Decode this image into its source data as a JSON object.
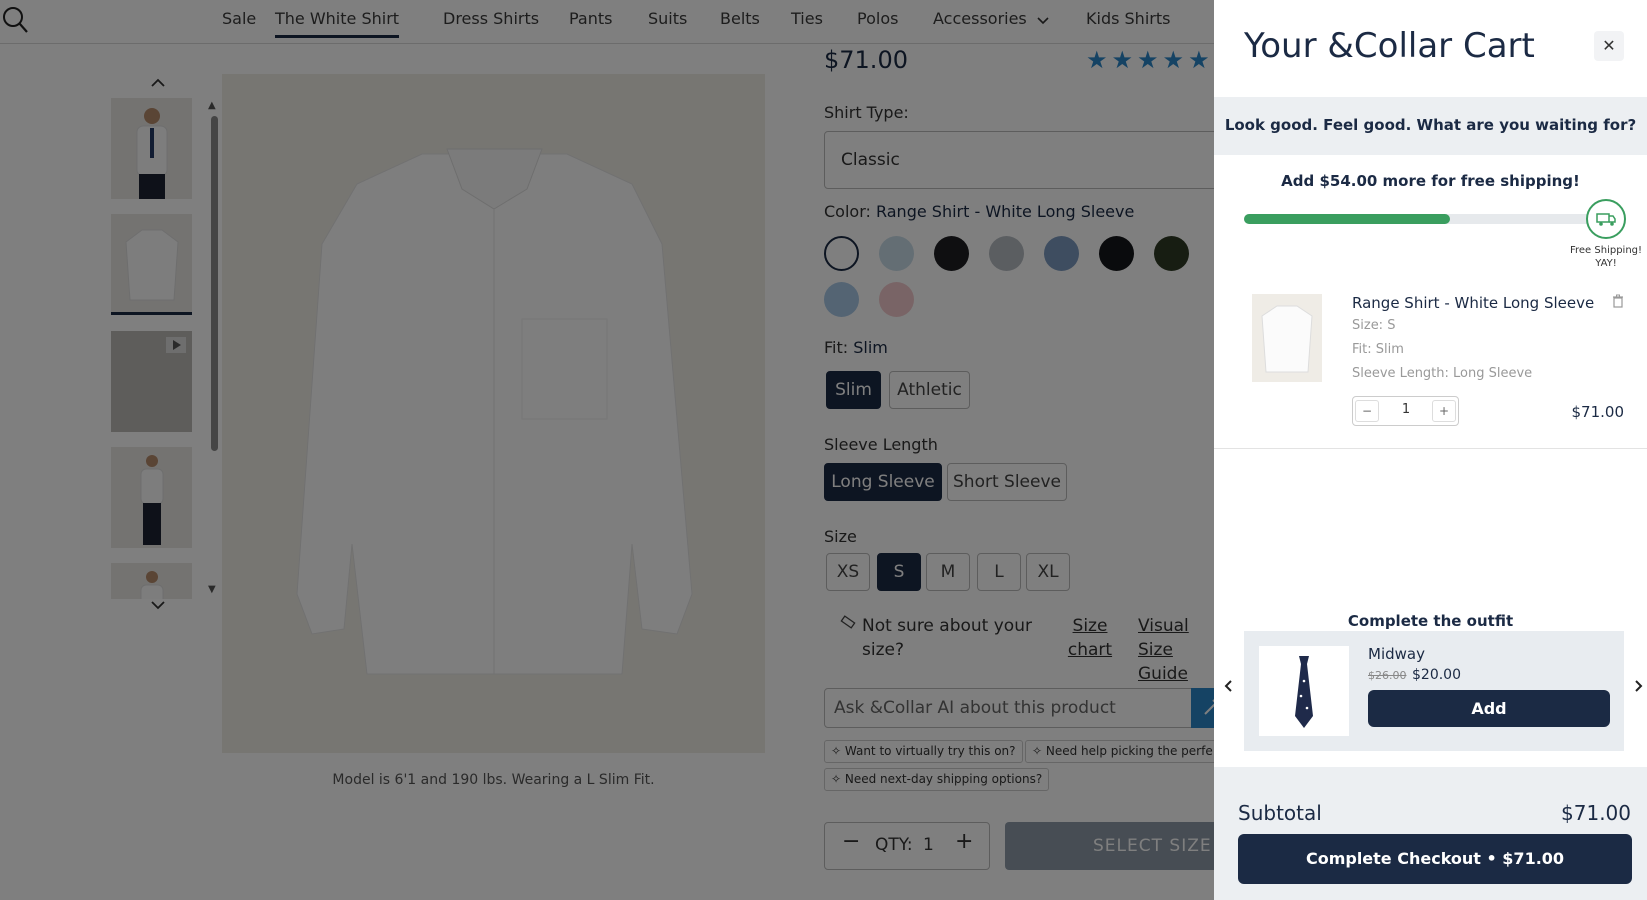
{
  "nav": {
    "items": [
      "Sale",
      "The White Shirt",
      "Dress Shirts",
      "Pants",
      "Suits",
      "Belts",
      "Ties",
      "Polos",
      "Accessories",
      "Kids Shirts"
    ],
    "active": "The White Shirt"
  },
  "product": {
    "price": "$71.00",
    "shirt_type_label": "Shirt Type:",
    "shirt_type_value": "Classic",
    "color_label": "Color:",
    "color_value": "Range Shirt - White Long Sleeve",
    "swatches": [
      "#ffffff",
      "#c9dce8",
      "#1e1f22",
      "#b6bcc2",
      "#7d9ac0",
      "#15161a",
      "#2f3a24",
      "#a8c8e6",
      "#f2c9cc"
    ],
    "fit_label": "Fit:",
    "fit_value": "Slim",
    "fit_options": [
      "Slim",
      "Athletic"
    ],
    "sleeve_label": "Sleeve Length",
    "sleeve_options": [
      "Long Sleeve",
      "Short Sleeve"
    ],
    "size_label": "Size",
    "size_options": [
      "XS",
      "S",
      "M",
      "L",
      "XL"
    ],
    "size_selected": "S",
    "size_question": "Not sure about your size?",
    "size_chart": "Size chart",
    "visual_guide": "Visual Size Guide",
    "ask_placeholder": "Ask &Collar AI about this product",
    "chips": [
      "Want to virtually try this on?",
      "Need help picking the perfe",
      "Need next-day shipping options?"
    ],
    "qty_label": "QTY:",
    "qty_value": "1",
    "select_size": "SELECT SIZE",
    "model_note": "Model is 6'1 and 190 lbs. Wearing a L Slim Fit."
  },
  "cart": {
    "title": "Your &Collar Cart",
    "banner": "Look good. Feel good. What are you waiting for?",
    "shipping_message": "Add $54.00 more for free shipping!",
    "shipping_progress": 0.58,
    "free_shipping_label": "Free Shipping!",
    "free_shipping_sub": "YAY!",
    "item": {
      "name": "Range Shirt - White Long Sleeve",
      "size": "Size: S",
      "fit": "Fit: Slim",
      "sleeve": "Sleeve Length: Long Sleeve",
      "qty": "1",
      "price": "$71.00"
    },
    "outfit": {
      "title": "Complete the outfit",
      "name": "Midway",
      "old_price": "$26.00",
      "new_price": "$20.00",
      "add_label": "Add"
    },
    "subtotal_label": "Subtotal",
    "subtotal_value": "$71.00",
    "checkout_label": "Complete Checkout • $71.00"
  },
  "colors": {
    "navy": "#1b2a44",
    "accent_blue": "#2a86c9",
    "progress_green": "#3a9e5f"
  }
}
